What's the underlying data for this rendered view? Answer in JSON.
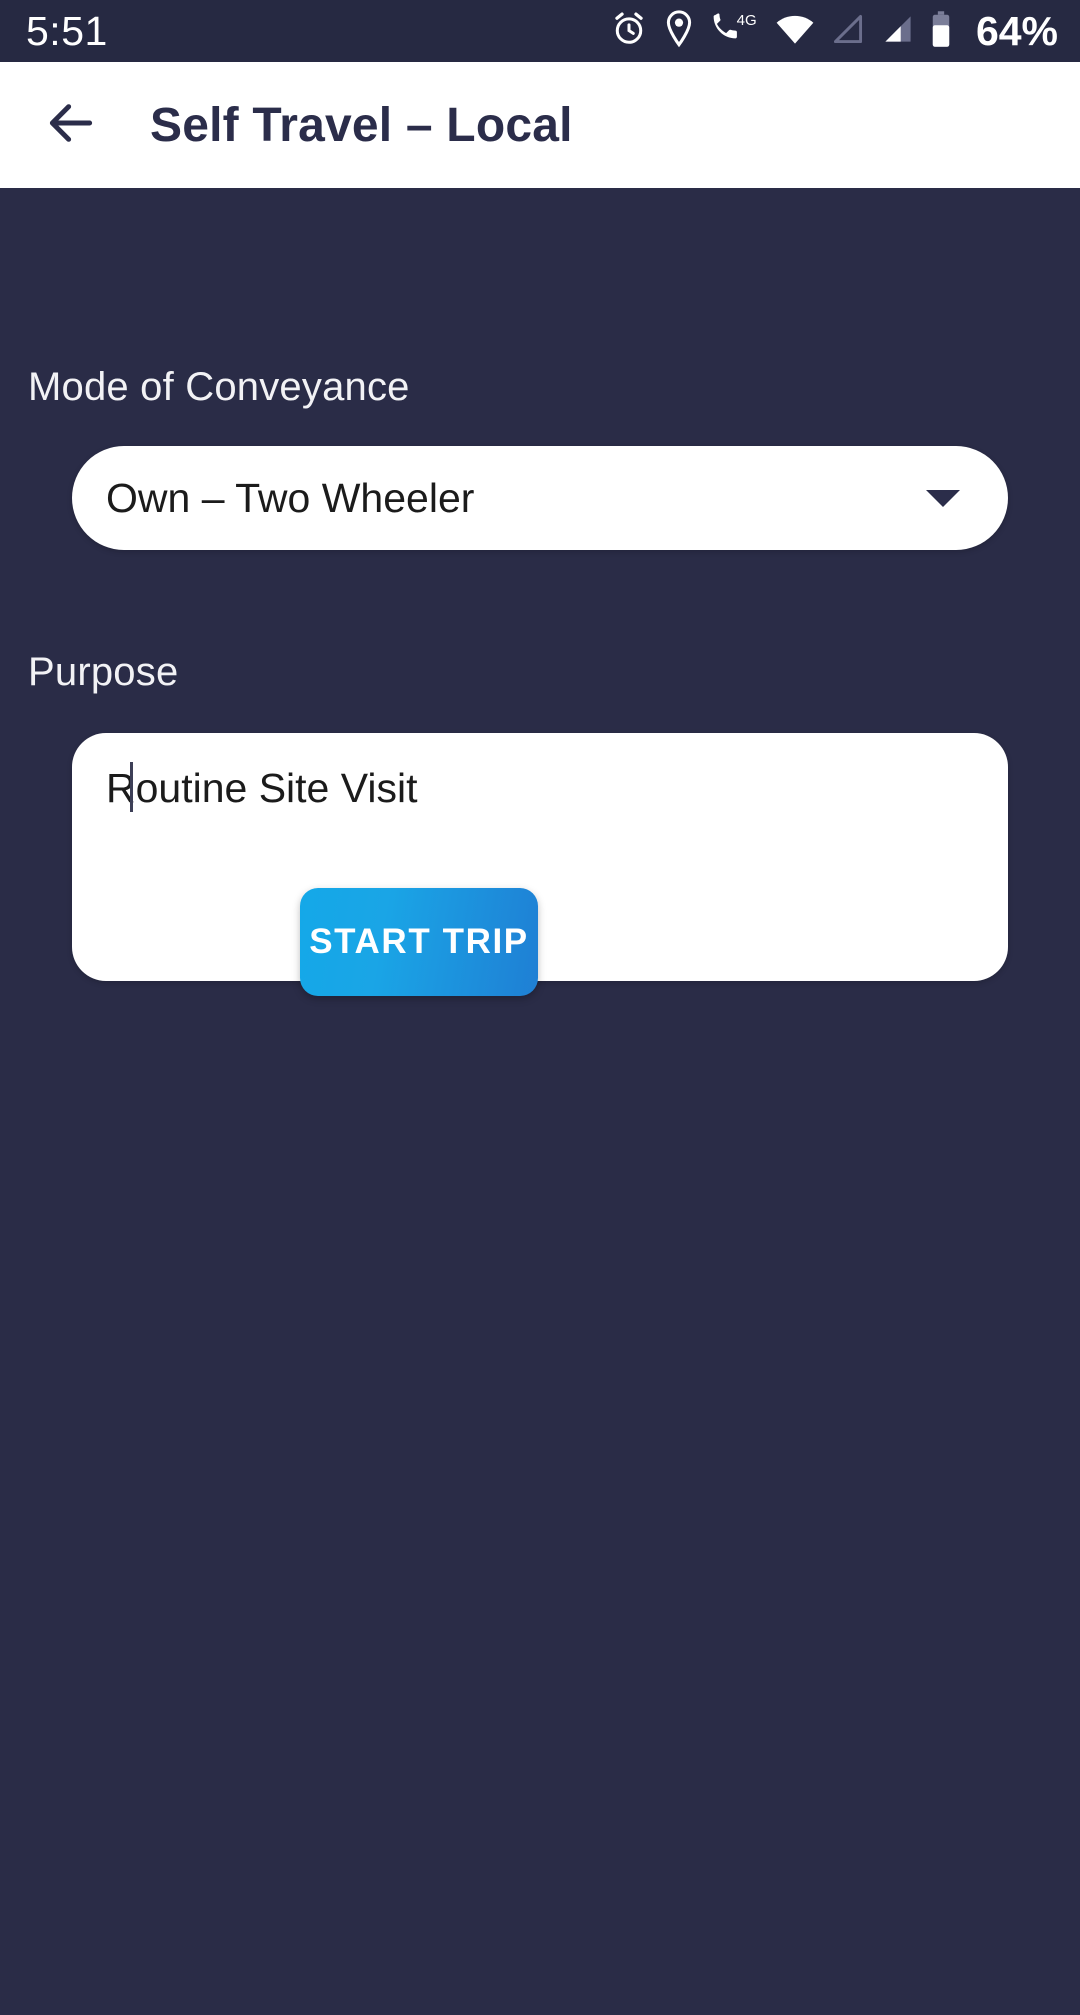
{
  "colors": {
    "status_bar_bg": "#262942",
    "app_bar_bg": "#ffffff",
    "page_bg": "#2a2c47",
    "text_on_dark": "#f2f2f5",
    "text_on_light": "#1b1b1b",
    "title_color": "#2b2d4a",
    "button_gradient_start": "#14a8e8",
    "button_gradient_end": "#1f7fd4",
    "field_bg": "#ffffff"
  },
  "status_bar": {
    "time": "5:51",
    "battery_percent": "64%",
    "network_label": "4G",
    "icons": [
      "alarm-clock-icon",
      "location-pin-icon",
      "call-4g-icon",
      "wifi-icon",
      "signal-sim1-icon",
      "signal-sim2-icon",
      "battery-icon"
    ]
  },
  "app_bar": {
    "back_icon": "back-arrow-icon",
    "title": "Self Travel – Local"
  },
  "form": {
    "mode_of_conveyance": {
      "label": "Mode of Conveyance",
      "selected_value": "Own – Two Wheeler",
      "dropdown_icon": "chevron-down-icon"
    },
    "purpose": {
      "label": "Purpose",
      "value": "Routine Site Visit",
      "placeholder": "",
      "caret_visible": true
    }
  },
  "actions": {
    "start_trip_label": "START TRIP"
  }
}
